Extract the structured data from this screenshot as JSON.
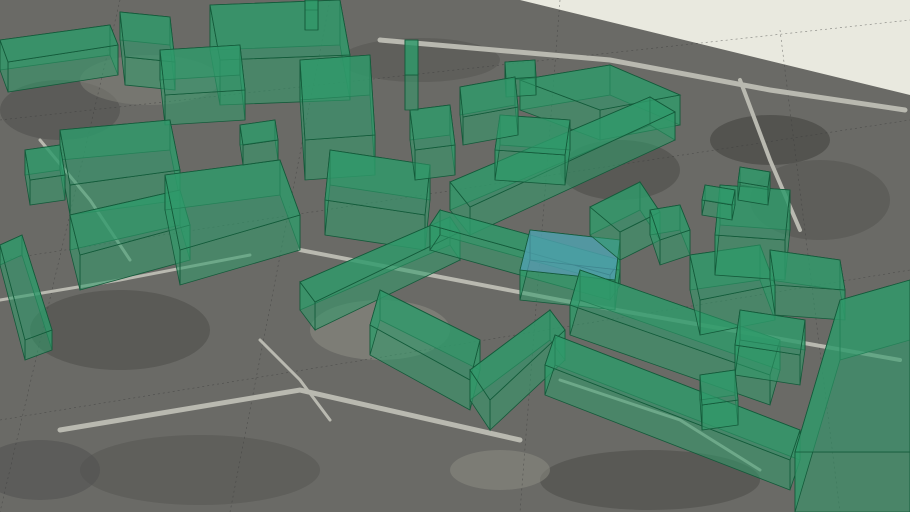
{
  "view": {
    "kind": "3d-model-view",
    "sky_color": "#e9e9df",
    "ground_tone": "#6b6b6b",
    "building_fill": "#2f9a6a",
    "building_edge": "#145a3a",
    "highlight_roof": "#5aa3c8"
  },
  "buildings": [
    {
      "id": "ne-block"
    },
    {
      "id": "nw-cluster"
    },
    {
      "id": "domed-complex"
    },
    {
      "id": "central-wing"
    },
    {
      "id": "west-long-block"
    },
    {
      "id": "south-l-block"
    },
    {
      "id": "east-long-block"
    },
    {
      "id": "east-corner-block"
    },
    {
      "id": "far-se-block"
    },
    {
      "id": "west-bar"
    }
  ]
}
